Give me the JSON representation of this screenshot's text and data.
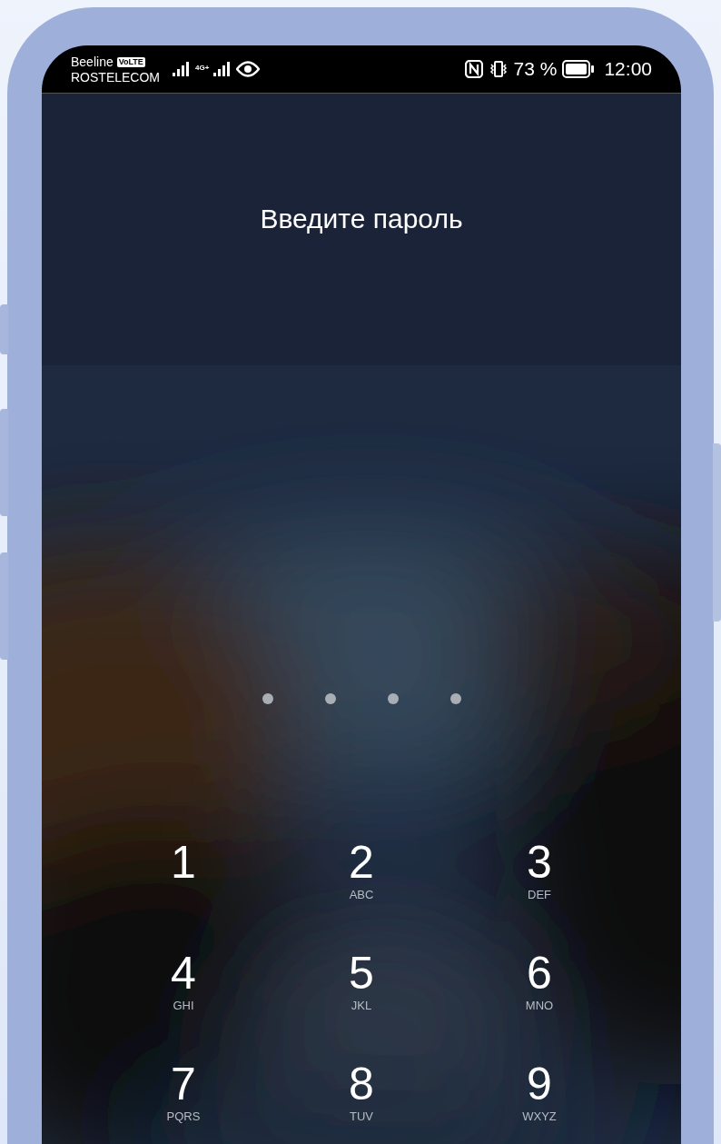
{
  "status_bar": {
    "carriers": [
      {
        "name": "Beeline",
        "badge": "VoLTE"
      },
      {
        "name": "ROSTELECOM"
      }
    ],
    "network_type": "4G+",
    "battery_percent": "73 %",
    "time": "12:00"
  },
  "lock_screen": {
    "title": "Введите пароль",
    "pin_dots": [
      {
        "filled": false
      },
      {
        "filled": false
      },
      {
        "filled": false
      },
      {
        "filled": false
      }
    ],
    "keys": [
      {
        "digit": "1"
      },
      {
        "digit": "2",
        "letters": "ABC"
      },
      {
        "digit": "3",
        "letters": "DEF"
      },
      {
        "digit": "4",
        "letters": "GHI"
      },
      {
        "digit": "5",
        "letters": "JKL"
      },
      {
        "digit": "6",
        "letters": "MNO"
      },
      {
        "digit": "7",
        "letters": "PQRS"
      },
      {
        "digit": "8",
        "letters": "TUV"
      },
      {
        "digit": "9",
        "letters": "WXYZ"
      }
    ]
  }
}
